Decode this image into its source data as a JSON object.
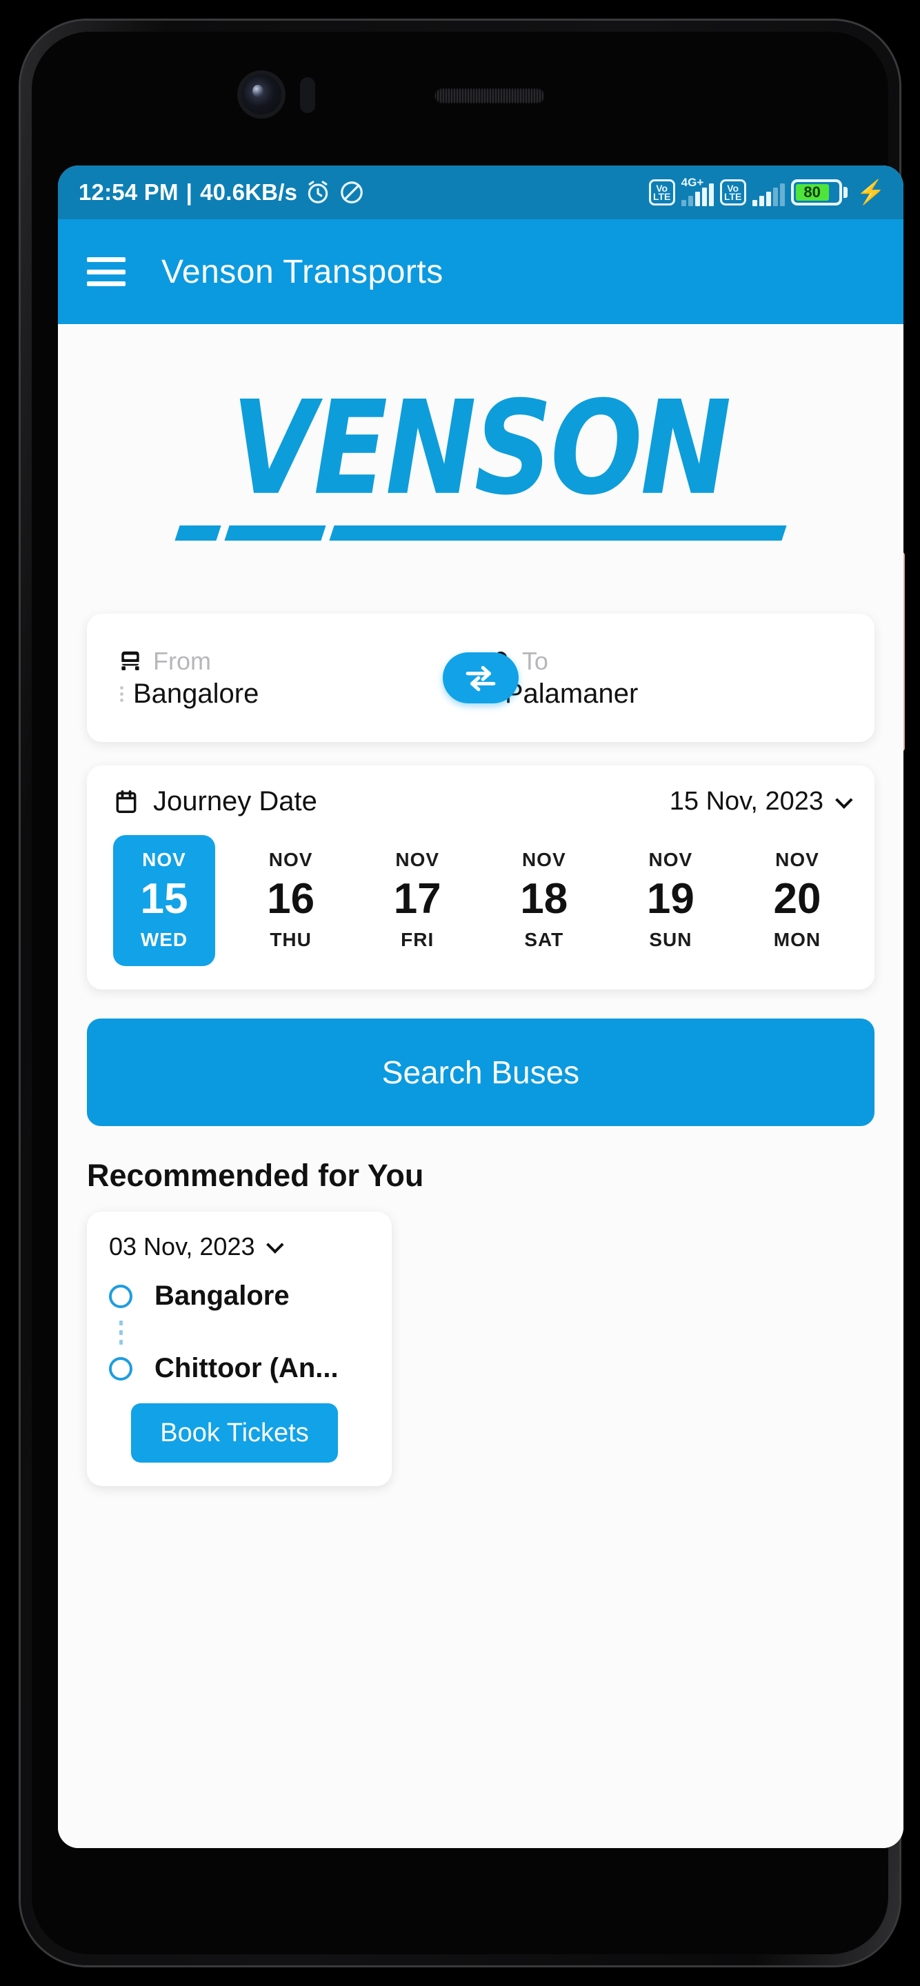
{
  "status_bar": {
    "time": "12:54 PM",
    "separator": "|",
    "network_speed": "40.6KB/s",
    "alarm_icon": "alarm-icon",
    "dnd_icon": "do-not-disturb-icon",
    "sim1_volte": "VoLTE",
    "sim1_network": "4G+",
    "sim2_volte": "VoLTE",
    "battery_level": "80",
    "charging_icon": "charging-bolt-icon"
  },
  "app_bar": {
    "menu_icon": "hamburger-menu-icon",
    "title": "Venson Transports"
  },
  "brand": {
    "logo_text": "VENSON"
  },
  "route": {
    "from_label": "From",
    "from_value": "Bangalore",
    "from_icon": "bus-icon",
    "to_label": "To",
    "to_value": "Palamaner",
    "to_icon": "location-pin-icon",
    "swap_icon": "swap-arrows-icon"
  },
  "journey": {
    "calendar_icon": "calendar-icon",
    "label": "Journey Date",
    "selected_date": "15 Nov, 2023",
    "chevron_icon": "chevron-down-icon",
    "dates": [
      {
        "month": "NOV",
        "day": "15",
        "dow": "WED",
        "selected": true
      },
      {
        "month": "NOV",
        "day": "16",
        "dow": "THU",
        "selected": false
      },
      {
        "month": "NOV",
        "day": "17",
        "dow": "FRI",
        "selected": false
      },
      {
        "month": "NOV",
        "day": "18",
        "dow": "SAT",
        "selected": false
      },
      {
        "month": "NOV",
        "day": "19",
        "dow": "SUN",
        "selected": false
      },
      {
        "month": "NOV",
        "day": "20",
        "dow": "MON",
        "selected": false
      }
    ]
  },
  "search": {
    "button_label": "Search Buses"
  },
  "recommended": {
    "section_title": "Recommended for You",
    "cards": [
      {
        "date": "03 Nov, 2023",
        "chevron_icon": "chevron-down-icon",
        "origin": "Bangalore",
        "destination": "Chittoor (An...",
        "book_label": "Book Tickets"
      }
    ]
  },
  "colors": {
    "accent_blue": "#0b9ae0",
    "button_blue": "#11a2e8",
    "status_blue": "#0d7fb5",
    "logo_blue": "#0d9ddb",
    "battery_green": "#4ee53a"
  }
}
